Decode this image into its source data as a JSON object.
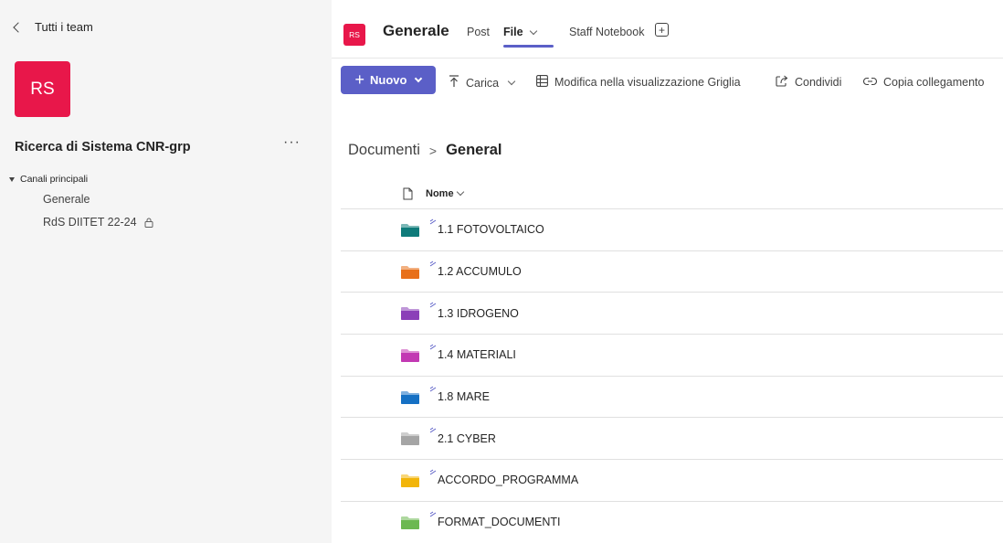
{
  "sidebar": {
    "back_label": "Tutti i team",
    "team_initials": "RS",
    "team_name": "Ricerca di Sistema CNR-grp",
    "more_label": "···",
    "section_label": "Canali principali",
    "channels": [
      {
        "label": "Generale"
      },
      {
        "label": "RdS DIITET 22-24"
      }
    ]
  },
  "header": {
    "channel_initials": "RS",
    "channel_title": "Generale",
    "tabs": [
      {
        "label": "Post"
      },
      {
        "label": "File"
      },
      {
        "label": "Staff Notebook"
      }
    ],
    "add_tab_label": "+"
  },
  "toolbar": {
    "new_label": "Nuovo",
    "upload_label": "Carica",
    "grid_label": "Modifica nella visualizzazione Griglia",
    "share_label": "Condividi",
    "copy_label": "Copia collegamento"
  },
  "breadcrumb": {
    "root": "Documenti",
    "current": "General"
  },
  "file_list": {
    "column_name": "Nome",
    "rows": [
      {
        "name": "1.1 FOTOVOLTAICO",
        "color": "#0f7b7a"
      },
      {
        "name": "1.2 ACCUMULO",
        "color": "#e8701a"
      },
      {
        "name": "1.3 IDROGENO",
        "color": "#8b3fb8"
      },
      {
        "name": "1.4 MATERIALI",
        "color": "#c239b3"
      },
      {
        "name": "1.8 MARE",
        "color": "#1570c4"
      },
      {
        "name": "2.1 CYBER",
        "color": "#a5a5a5"
      },
      {
        "name": "ACCORDO_PROGRAMMA",
        "color": "#f2b50a"
      },
      {
        "name": "FORMAT_DOCUMENTI",
        "color": "#6cb851"
      }
    ]
  },
  "colors": {
    "brand_accent": "#5b5fc7",
    "team_avatar": "#e8174a"
  }
}
